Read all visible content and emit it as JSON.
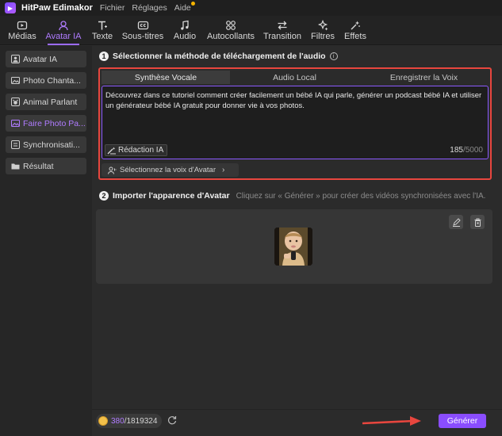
{
  "titlebar": {
    "app_name": "HitPaw Edimakor",
    "menu": [
      "Fichier",
      "Réglages",
      "Aide"
    ]
  },
  "toolbar": {
    "items": [
      {
        "label": "Médias",
        "icon": "media-icon"
      },
      {
        "label": "Avatar IA",
        "icon": "avatar-icon",
        "active": true
      },
      {
        "label": "Texte",
        "icon": "text-icon"
      },
      {
        "label": "Sous-titres",
        "icon": "subtitles-icon"
      },
      {
        "label": "Audio",
        "icon": "music-icon"
      },
      {
        "label": "Autocollants",
        "icon": "stickers-icon"
      },
      {
        "label": "Transition",
        "icon": "transition-icon"
      },
      {
        "label": "Filtres",
        "icon": "filters-icon"
      },
      {
        "label": "Effets",
        "icon": "effects-icon"
      }
    ]
  },
  "sidebar": {
    "items": [
      {
        "label": "Avatar IA",
        "icon": "avatar-icon"
      },
      {
        "label": "Photo Chanta...",
        "icon": "photo-icon"
      },
      {
        "label": "Animal Parlant",
        "icon": "animal-icon"
      },
      {
        "label": "Faire Photo Pa...",
        "icon": "photo-icon",
        "active": true
      },
      {
        "label": "Synchronisati...",
        "icon": "sync-icon"
      },
      {
        "label": "Résultat",
        "icon": "folder-icon"
      }
    ]
  },
  "section1": {
    "number": "1",
    "title": "Sélectionner la méthode de téléchargement de l'audio",
    "tabs": [
      "Synthèse Vocale",
      "Audio Local",
      "Enregistrer la Voix"
    ],
    "text": "Découvrez dans ce tutoriel comment créer facilement un bébé IA qui parle, générer un podcast bébé IA et utiliser un générateur bébé IA gratuit pour donner vie à vos photos.",
    "redaction_label": "Rédaction IA",
    "char_count": "185",
    "char_max": "/5000",
    "voice_label": "Sélectionnez la voix d'Avatar"
  },
  "section2": {
    "number": "2",
    "title": "Importer l'apparence d'Avatar",
    "hint": "Cliquez sur « Générer » pour créer des vidéos synchronisées avec l'IA."
  },
  "bottom": {
    "credits_used": "380",
    "credits_total": "/1819324",
    "generate_label": "Générer"
  },
  "colors": {
    "accent": "#9b6bff",
    "highlight_border": "#e8463e",
    "generate": "#8a4dff"
  }
}
